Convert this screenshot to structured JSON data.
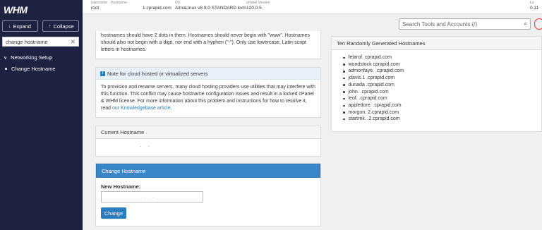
{
  "sidebar": {
    "logo": "WHM",
    "expand_label": "Expand",
    "collapse_label": "Collapse",
    "search_value": "change hostname",
    "section": "Networking Setup",
    "item": "Change Hostname"
  },
  "topbar": {
    "username_h": "Username",
    "username": "root",
    "hostname_h": "Hostname",
    "hostname": "1.cprapid.com",
    "os_h": "OS",
    "os": "AlmaLinux v8.9.0 STANDARD kvm",
    "cpanel_h": "cPanel Version",
    "cpanel": "120.0.5",
    "load_h": "Lo",
    "load": "0.11"
  },
  "tools_search": {
    "placeholder": "Search Tools and Accounts (/)"
  },
  "intro": {
    "text": "hostnames should have 2 dots in them. Hostnames should never begin with \"www\". Hostnames should also not begin with a digit, nor end with a hyphen (\"-\"). Only use lowercase, Latin-script letters in hostnames."
  },
  "note": {
    "title": "Note for cloud hosted or virtualized servers",
    "body": "To provision and rename servers, many cloud hosting providers use utilities that may interfere with this function. This conflict may cause hostname configuration issues and result in a locked cPanel & WHM license. For more information about this problem and instructions for how to resolve it, read ",
    "link": "our Knowledgebase article",
    "end": "."
  },
  "current": {
    "title": "Current Hostname",
    "value": ". ."
  },
  "change": {
    "title": "Change Hostname",
    "label": "New Hostname:",
    "input_value": ". .",
    "button": "Change"
  },
  "random": {
    "title": "Ten Randomly Generated Hostnames",
    "items": [
      "felarof.           cprapid.com",
      "woodstock                    cprapid.com",
      "admonfaye.              .cprapid.com",
      "jdavis.1                  .cprapid.com",
      "dunada                   .cprapid.com",
      "john.                     .cprapid.com",
      "leof.                     .cprapid.com",
      "appledore.                  .cprapid.com",
      "morgon.                  2.cprapid.com",
      "startrek.                .2.cprapid.com"
    ]
  }
}
